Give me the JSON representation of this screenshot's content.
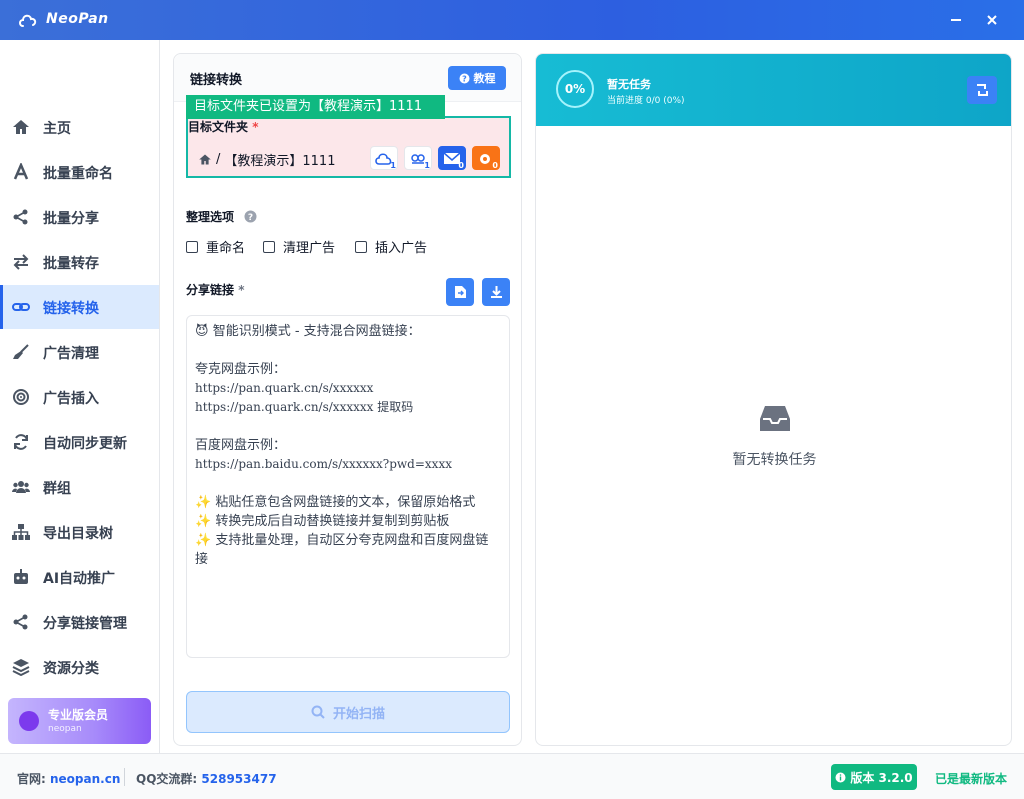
{
  "app": {
    "title": "NeoPan"
  },
  "sidebar": {
    "items": [
      {
        "label": "主页",
        "icon": "home-icon"
      },
      {
        "label": "批量重命名",
        "icon": "font-icon"
      },
      {
        "label": "批量分享",
        "icon": "share-icon"
      },
      {
        "label": "批量转存",
        "icon": "swap-icon"
      },
      {
        "label": "链接转换",
        "icon": "link-icon",
        "active": true
      },
      {
        "label": "广告清理",
        "icon": "broom-icon"
      },
      {
        "label": "广告插入",
        "icon": "target-icon"
      },
      {
        "label": "自动同步更新",
        "icon": "sync-icon"
      },
      {
        "label": "群组",
        "icon": "users-icon"
      },
      {
        "label": "导出目录树",
        "icon": "sitemap-icon"
      },
      {
        "label": "AI自动推广",
        "icon": "robot-icon"
      },
      {
        "label": "分享链接管理",
        "icon": "share-icon"
      },
      {
        "label": "资源分类",
        "icon": "layers-icon"
      }
    ],
    "pro": {
      "title": "专业版会员",
      "user": "neopan"
    }
  },
  "panel": {
    "title": "链接转换",
    "tutorial_label": "教程",
    "tooltip": "目标文件夹已设置为【教程演示】1111",
    "folder_label": "目标文件夹",
    "required_mark": "*",
    "folder_path_sep": "/",
    "folder_path": "【教程演示】1111",
    "cloud_counts": [
      "1",
      "1",
      "0",
      "0"
    ],
    "options_label": "整理选项",
    "options": [
      "重命名",
      "清理广告",
      "插入广告"
    ],
    "share_label": "分享链接",
    "textarea": {
      "l1": "智能识别模式 - 支持混合网盘链接：",
      "l2": "夸克网盘示例：",
      "l3": "https://pan.quark.cn/s/xxxxxx",
      "l4": "https://pan.quark.cn/s/xxxxxx 提取码",
      "l5": "百度网盘示例：",
      "l6": "https://pan.baidu.com/s/xxxxxx?pwd=xxxx",
      "l7": "粘贴任意包含网盘链接的文本，保留原始格式",
      "l8": "转换完成后自动替换链接并复制到剪贴板",
      "l9": "支持批量处理，自动区分夸克网盘和百度网盘链接"
    },
    "scan_label": "开始扫描"
  },
  "task": {
    "percent": "0%",
    "title": "暂无任务",
    "progress": "当前进度 0/0 (0%)",
    "empty": "暂无转换任务"
  },
  "footer": {
    "site_label": "官网:",
    "site": "neopan.cn",
    "qq_label": "QQ交流群:",
    "qq": "528953477",
    "version": "版本 3.2.0",
    "latest": "已是最新版本"
  }
}
